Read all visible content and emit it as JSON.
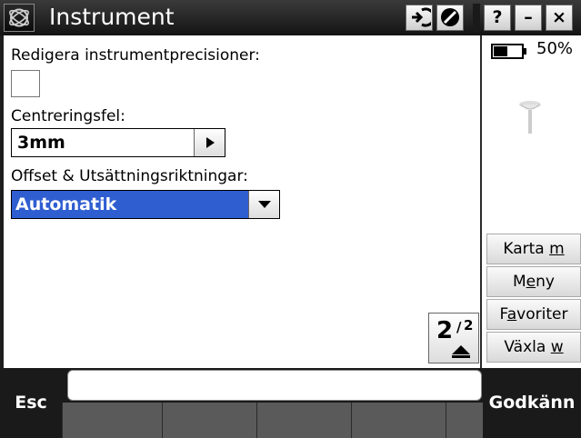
{
  "title": "Instrument",
  "titlebar": {
    "app_icon": "trimble-globe-icon",
    "connect_icon": "arrow-in-icon",
    "disable_icon": "no-entry-icon",
    "help_label": "?",
    "minimize_label": "–",
    "close_label": "×"
  },
  "form": {
    "precision_label": "Redigera instrumentprecisioner:",
    "precision_checked": false,
    "centering_label": "Centreringsfel:",
    "centering_value": "3mm",
    "offset_label": "Offset & Utsättningsriktningar:",
    "offset_value": "Automatik"
  },
  "page_indicator": {
    "current": "2",
    "total": "2"
  },
  "status": {
    "battery_percent": "50%"
  },
  "side_menu": {
    "items": [
      {
        "pre": "Karta ",
        "key": "m",
        "post": ""
      },
      {
        "pre": "M",
        "key": "e",
        "post": "ny"
      },
      {
        "pre": "F",
        "key": "a",
        "post": "voriter"
      },
      {
        "pre": "Växla ",
        "key": "w",
        "post": ""
      }
    ]
  },
  "bottom": {
    "esc_label": "Esc",
    "accept_label": "Godkänn",
    "status_text": ""
  },
  "colors": {
    "selection": "#2f5ed1",
    "titlebar": "#1a1a1a"
  }
}
